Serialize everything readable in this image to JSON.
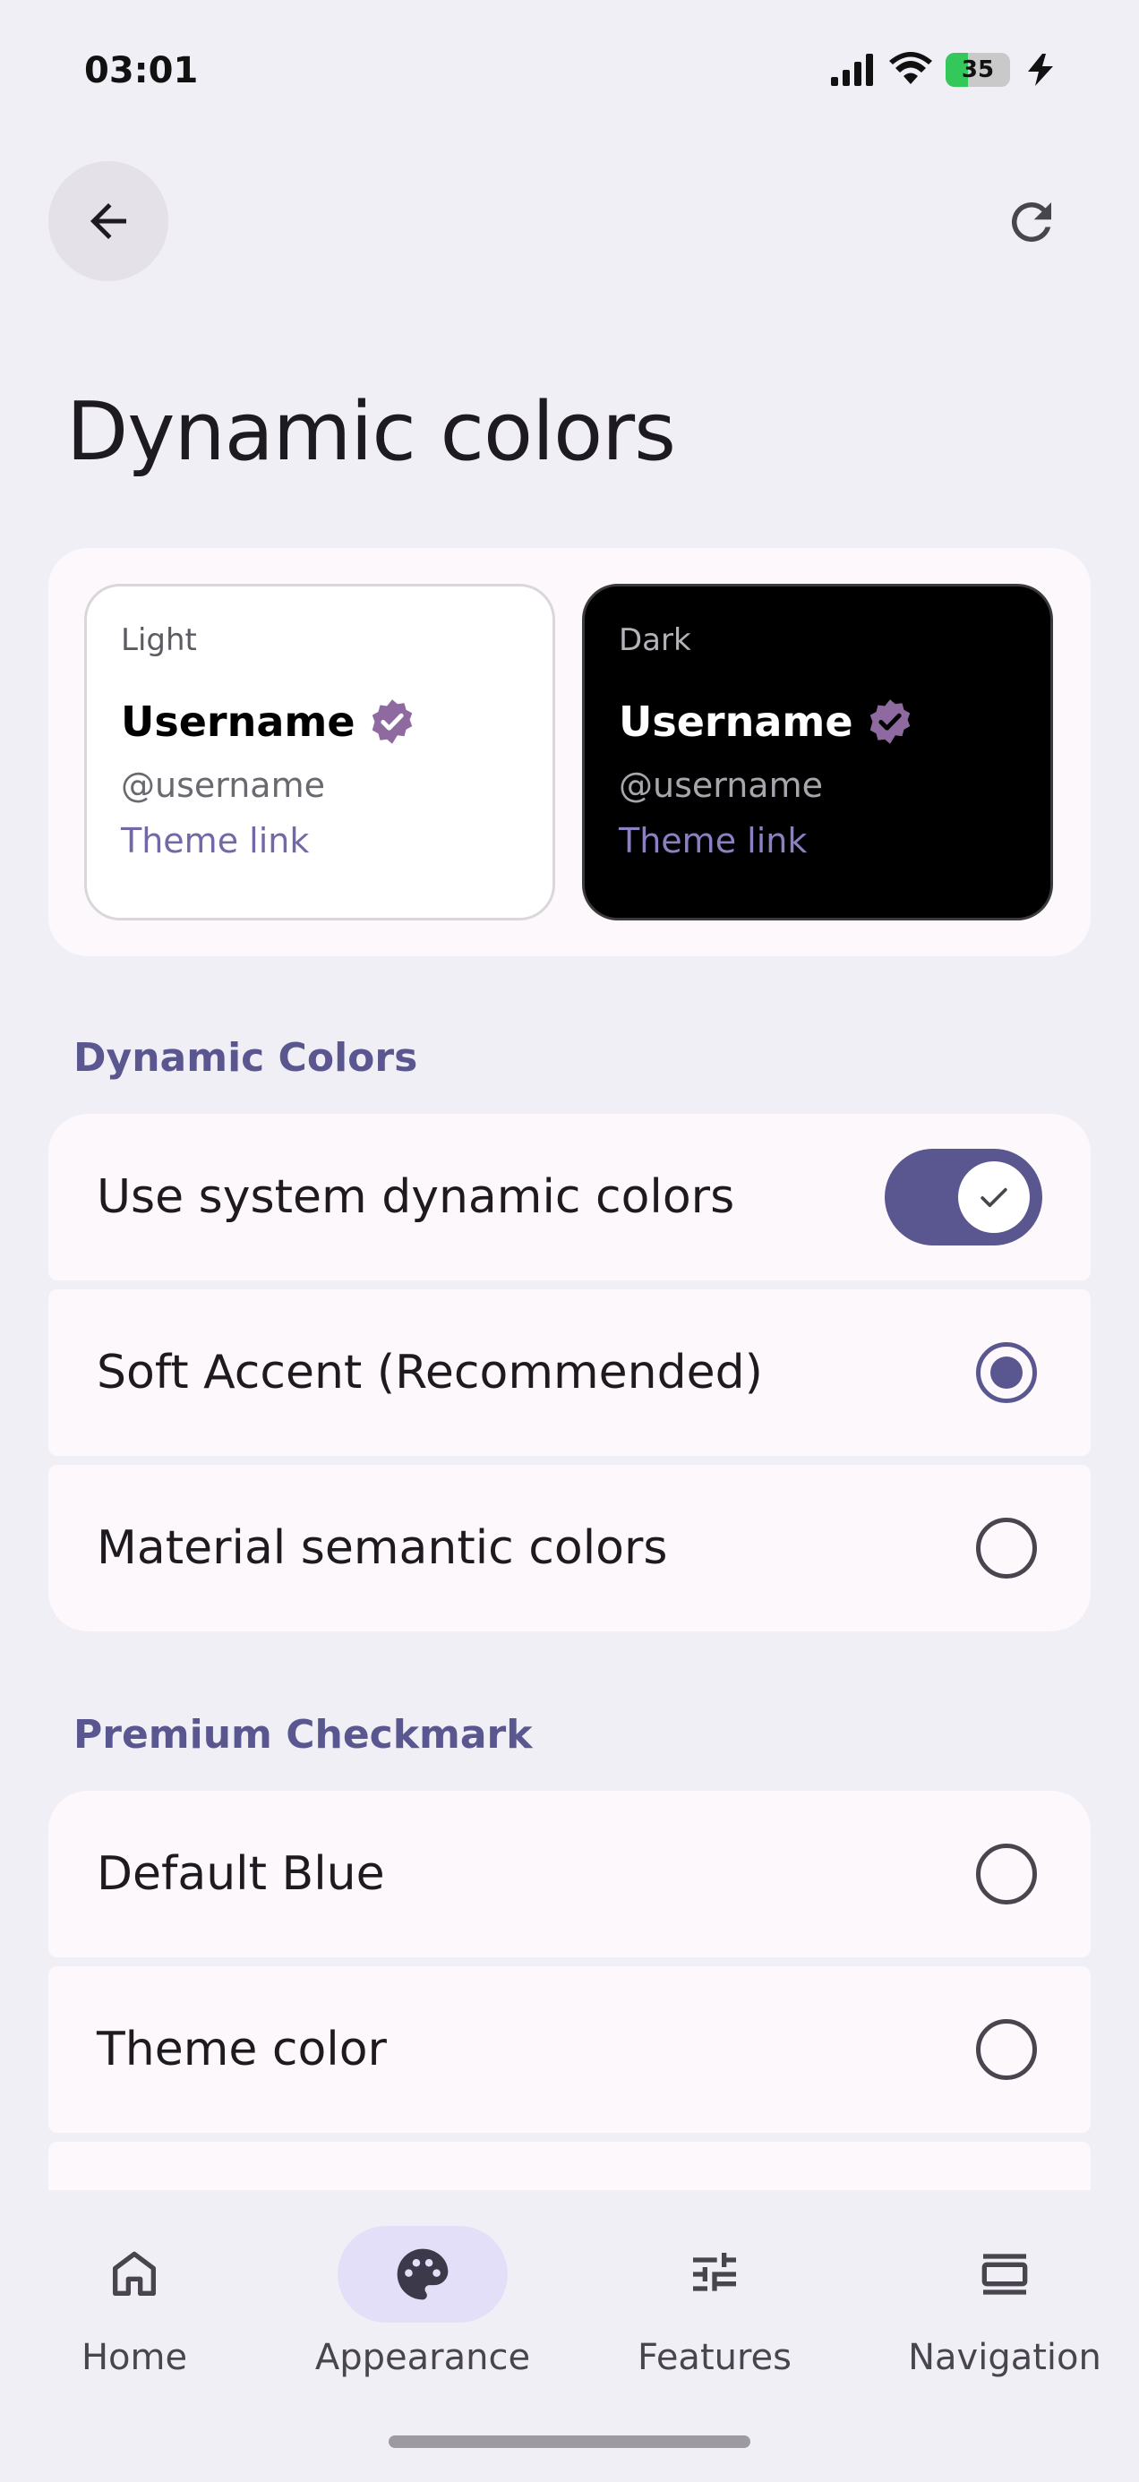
{
  "status_bar": {
    "time": "03:01",
    "battery": "35"
  },
  "page": {
    "title": "Dynamic colors"
  },
  "preview": {
    "light": {
      "label": "Light",
      "username": "Username",
      "handle": "@username",
      "link": "Theme link"
    },
    "dark": {
      "label": "Dark",
      "username": "Username",
      "handle": "@username",
      "link": "Theme link"
    }
  },
  "dynamic_colors": {
    "header": "Dynamic Colors",
    "items": [
      {
        "label": "Use system dynamic colors",
        "control": "switch",
        "checked": true
      },
      {
        "label": "Soft Accent (Recommended)",
        "control": "radio",
        "selected": true
      },
      {
        "label": "Material semantic colors",
        "control": "radio",
        "selected": false
      }
    ]
  },
  "premium_checkmark": {
    "header": "Premium Checkmark",
    "items": [
      {
        "label": "Default Blue",
        "control": "radio",
        "selected": false
      },
      {
        "label": "Theme color",
        "control": "radio",
        "selected": false
      }
    ]
  },
  "bottom_nav": {
    "items": [
      {
        "label": "Home",
        "icon": "home-icon",
        "active": false
      },
      {
        "label": "Appearance",
        "icon": "palette-icon",
        "active": true
      },
      {
        "label": "Features",
        "icon": "tune-icon",
        "active": false
      },
      {
        "label": "Navigation",
        "icon": "navigation-icon",
        "active": false
      }
    ]
  },
  "colors": {
    "accent": "#5a5690",
    "background": "#f1eff6",
    "surface": "#fdf8fc",
    "verified_badge": "#8e6aa0"
  }
}
